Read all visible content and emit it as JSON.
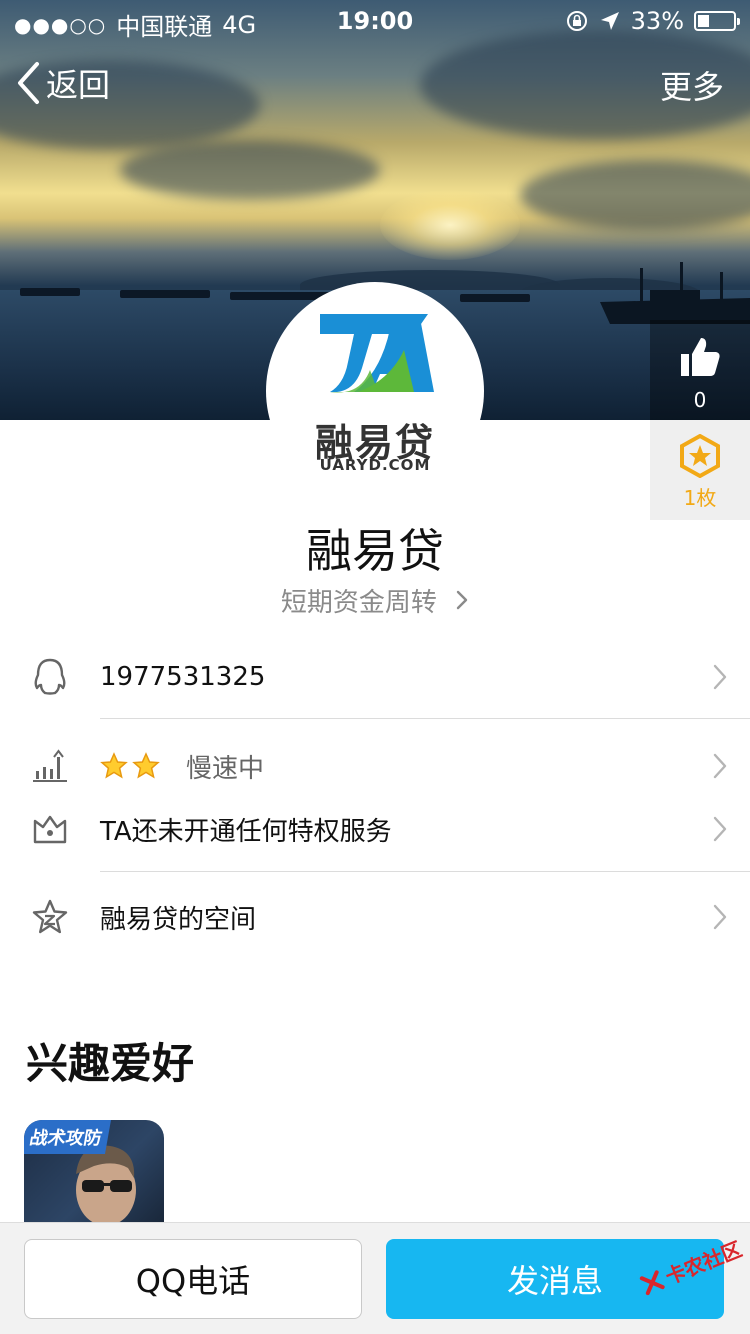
{
  "status_bar": {
    "signal": "●●●○○",
    "carrier": "中国联通",
    "network": "4G",
    "time": "19:00",
    "battery_text": "33%",
    "battery_level": 0.33
  },
  "nav": {
    "back_label": "返回",
    "more_label": "更多"
  },
  "actions": {
    "like_count": "0",
    "badge_count": "1枚"
  },
  "avatar": {
    "brand_cn": "融易贷",
    "brand_en": "UARYD.COM"
  },
  "profile": {
    "name": "融易贷",
    "signature": "短期资金周转"
  },
  "list": {
    "qq_number": "1977531325",
    "level_text": "慢速中",
    "privilege_text": "TA还未开通任何特权服务",
    "space_text": "融易贷的空间"
  },
  "interests": {
    "title": "兴趣爱好",
    "game_tag": "战术攻防"
  },
  "bottom": {
    "call_label": "QQ电话",
    "message_label": "发消息"
  },
  "watermark": {
    "text": "卡农社区"
  },
  "colors": {
    "accent_blue": "#17b7f1",
    "badge_orange": "#f2a916",
    "logo_blue": "#1a8fd6",
    "logo_green": "#5db83a"
  }
}
